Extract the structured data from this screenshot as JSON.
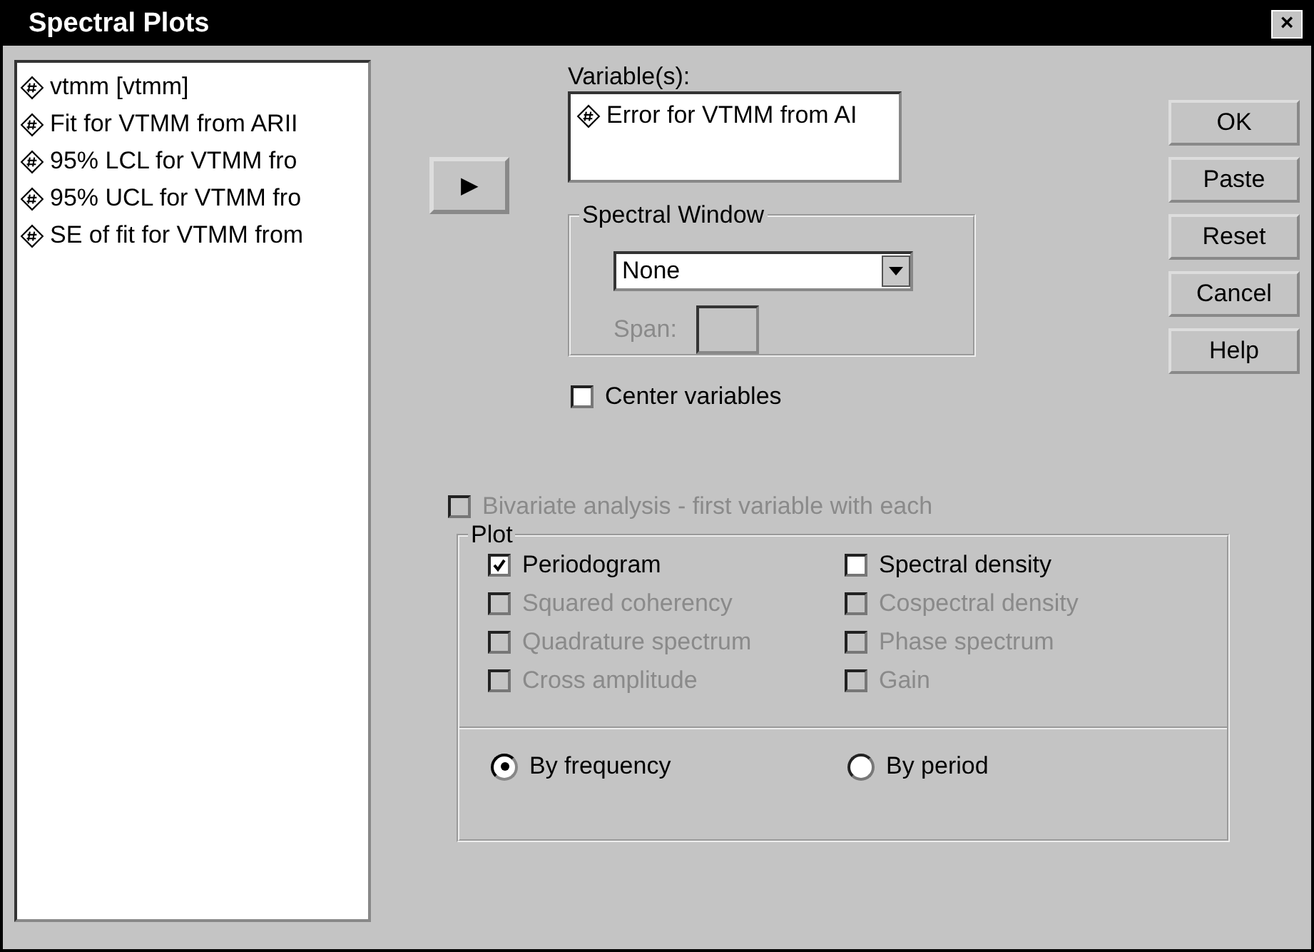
{
  "window": {
    "title": "Spectral Plots",
    "close_label": "×"
  },
  "source_list": [
    {
      "label": "vtmm [vtmm]"
    },
    {
      "label": "Fit for VTMM from ARII"
    },
    {
      "label": "95% LCL for VTMM fro"
    },
    {
      "label": "95% UCL for VTMM fro"
    },
    {
      "label": "SE of fit for VTMM from"
    }
  ],
  "move_button": "▶",
  "variables": {
    "label": "Variable(s):",
    "items": [
      {
        "label": "Error for VTMM from AI"
      }
    ]
  },
  "spectral_window": {
    "title": "Spectral Window",
    "dropdown_value": "None",
    "span_label": "Span:",
    "span_disabled": true
  },
  "center_variables": {
    "label": "Center variables",
    "checked": false,
    "disabled": false
  },
  "bivariate": {
    "label": "Bivariate analysis - first variable with each",
    "checked": false,
    "disabled": true
  },
  "plot": {
    "title": "Plot",
    "options": [
      {
        "label": "Periodogram",
        "checked": true,
        "disabled": false
      },
      {
        "label": "Spectral density",
        "checked": false,
        "disabled": false
      },
      {
        "label": "Squared coherency",
        "checked": false,
        "disabled": true
      },
      {
        "label": "Cospectral density",
        "checked": false,
        "disabled": true
      },
      {
        "label": "Quadrature spectrum",
        "checked": false,
        "disabled": true
      },
      {
        "label": "Phase spectrum",
        "checked": false,
        "disabled": true
      },
      {
        "label": "Cross amplitude",
        "checked": false,
        "disabled": true
      },
      {
        "label": "Gain",
        "checked": false,
        "disabled": true
      }
    ],
    "scale": [
      {
        "label": "By frequency",
        "selected": true
      },
      {
        "label": "By period",
        "selected": false
      }
    ]
  },
  "buttons": [
    "OK",
    "Paste",
    "Reset",
    "Cancel",
    "Help"
  ]
}
